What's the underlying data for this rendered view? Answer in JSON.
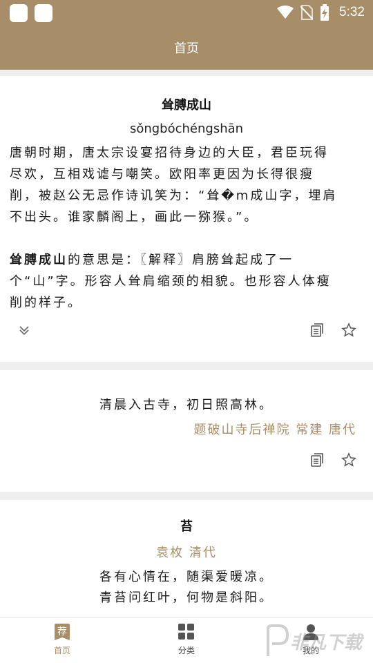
{
  "status_bar": {
    "time": "5:32"
  },
  "header": {
    "title": "首页"
  },
  "card_idiom": {
    "title": "耸膊成山",
    "pinyin": "sǒngbóchéngshān",
    "story_lines": [
      "唐朝时期，唐太宗设宴招待身边的大臣，君臣玩得",
      "尽欢，互相戏谑与嘲笑。欧阳率更因为长得很瘦",
      "削，被赵公无忌作诗讥笑为：“耸�m成山字，埋肩",
      "不出头。谁家麟阁上，画此一猕猴。”。"
    ],
    "meaning_term": "耸膊成山",
    "meaning_line1_rest": "的意思是：〖解释〗肩膀耸起成了一",
    "meaning_lines": [
      "个“山”字。形容人耸肩缩颈的相貌。也形容人体瘦",
      "削的样子。"
    ]
  },
  "card_poem1": {
    "line": "清晨入古寺，初日照高林。",
    "source": "题破山寺后禅院  常建  唐代"
  },
  "card_poem2": {
    "title": "苔",
    "author": "袁枚  清代",
    "lines": [
      "各有心情在，随渠爱暖凉。",
      "青苔问红叶，何物是斜阳。"
    ]
  },
  "bottom_nav": {
    "home_badge": "荐",
    "home": "首页",
    "category": "分类",
    "me": "我的"
  },
  "watermark": "非凡下载",
  "colors": {
    "accent": "#a88e68",
    "background": "#efefef",
    "card": "#ffffff"
  }
}
